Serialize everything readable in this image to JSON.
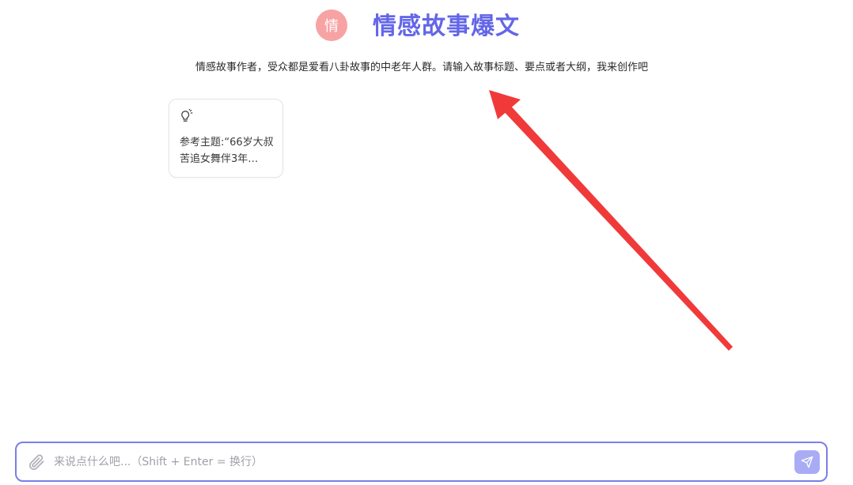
{
  "header": {
    "avatar_glyph": "情",
    "title": "情感故事爆文"
  },
  "description": "情感故事作者，受众都是爱看八卦故事的中老年人群。请输入故事标题、要点或者大纲，我来创作吧",
  "suggestions": [
    {
      "icon": "lightbulb-icon",
      "text": "参考主题:“66岁大叔苦追女舞伴3年…"
    }
  ],
  "composer": {
    "placeholder": "来说点什么吧...（Shift + Enter = 换行）",
    "attach_icon": "paperclip-icon",
    "send_icon": "send-icon"
  },
  "colors": {
    "brand": "#6366e8",
    "avatar_bg": "#f7a3a3",
    "composer_border": "#7b7ee6",
    "send_bg": "#a9acf5",
    "annotation_arrow": "#f03a3a"
  }
}
